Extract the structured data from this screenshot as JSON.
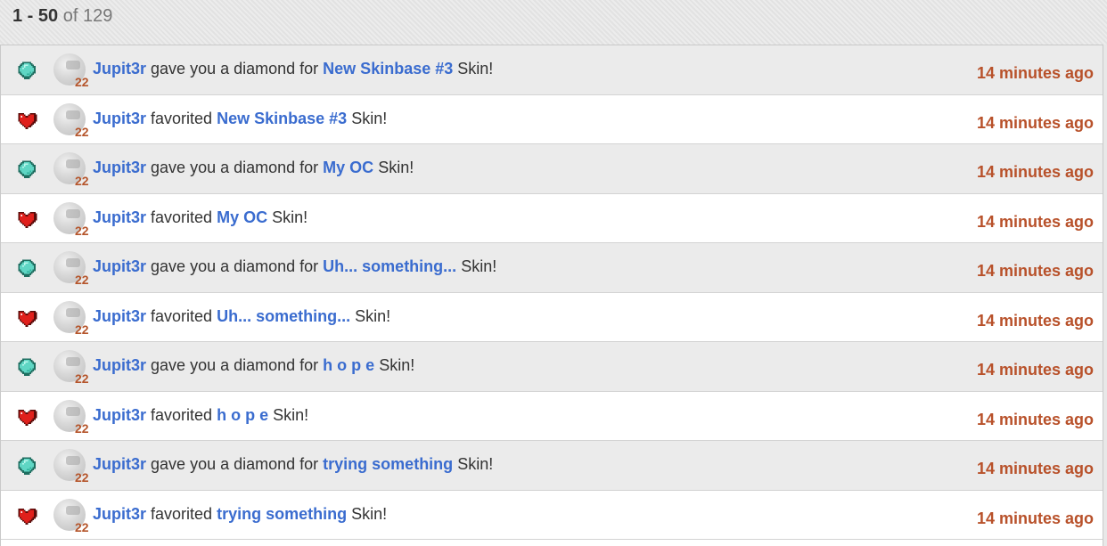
{
  "header": {
    "range": "1 - 50",
    "of": "of 129"
  },
  "colors": {
    "link": "#3a6ccf",
    "time": "#b8512a",
    "level": "#b5552b",
    "diamond": "#5fd6c4",
    "heart": "#e0201c"
  },
  "rows": [
    {
      "icon": "diamond-icon",
      "user": "Jupit3r",
      "level": "22",
      "action": "gave you a diamond for",
      "title": "New Skinbase #3",
      "suffix": "Skin!",
      "time": "14 minutes ago"
    },
    {
      "icon": "heart-icon",
      "user": "Jupit3r",
      "level": "22",
      "action": "favorited",
      "title": "New Skinbase #3",
      "suffix": "Skin!",
      "time": "14 minutes ago"
    },
    {
      "icon": "diamond-icon",
      "user": "Jupit3r",
      "level": "22",
      "action": "gave you a diamond for",
      "title": "My OC",
      "suffix": "Skin!",
      "time": "14 minutes ago"
    },
    {
      "icon": "heart-icon",
      "user": "Jupit3r",
      "level": "22",
      "action": "favorited",
      "title": "My OC",
      "suffix": "Skin!",
      "time": "14 minutes ago"
    },
    {
      "icon": "diamond-icon",
      "user": "Jupit3r",
      "level": "22",
      "action": "gave you a diamond for",
      "title": "Uh... something...",
      "suffix": "Skin!",
      "time": "14 minutes ago"
    },
    {
      "icon": "heart-icon",
      "user": "Jupit3r",
      "level": "22",
      "action": "favorited",
      "title": "Uh... something...",
      "suffix": "Skin!",
      "time": "14 minutes ago"
    },
    {
      "icon": "diamond-icon",
      "user": "Jupit3r",
      "level": "22",
      "action": "gave you a diamond for",
      "title": "h o p e",
      "suffix": "Skin!",
      "time": "14 minutes ago"
    },
    {
      "icon": "heart-icon",
      "user": "Jupit3r",
      "level": "22",
      "action": "favorited",
      "title": "h o p e",
      "suffix": "Skin!",
      "time": "14 minutes ago"
    },
    {
      "icon": "diamond-icon",
      "user": "Jupit3r",
      "level": "22",
      "action": "gave you a diamond for",
      "title": "trying something",
      "suffix": "Skin!",
      "time": "14 minutes ago"
    },
    {
      "icon": "heart-icon",
      "user": "Jupit3r",
      "level": "22",
      "action": "favorited",
      "title": "trying something",
      "suffix": "Skin!",
      "time": "14 minutes ago"
    }
  ]
}
